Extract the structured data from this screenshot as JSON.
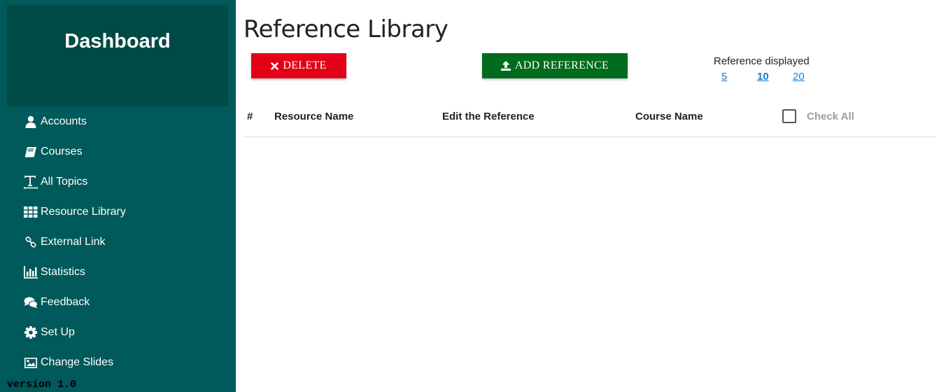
{
  "sidebar": {
    "brand": "Dashboard",
    "items": [
      {
        "label": "Accounts",
        "icon": "user-icon"
      },
      {
        "label": "Courses",
        "icon": "book-icon"
      },
      {
        "label": "All Topics",
        "icon": "text-icon"
      },
      {
        "label": "Resource Library",
        "icon": "grid-icon"
      },
      {
        "label": "External Link",
        "icon": "link-icon"
      },
      {
        "label": "Statistics",
        "icon": "bar-chart-icon"
      },
      {
        "label": "Feedback",
        "icon": "comments-icon"
      },
      {
        "label": "Set Up",
        "icon": "gear-icon"
      },
      {
        "label": "Change Slides",
        "icon": "image-icon"
      }
    ],
    "version": "version 1.0"
  },
  "main": {
    "title": "Reference Library",
    "delete_label": "DELETE",
    "add_label": "ADD REFERENCE",
    "per_page": {
      "label": "Reference displayed",
      "options": [
        "5",
        "10",
        "20"
      ],
      "selected": "10"
    },
    "table": {
      "headers": [
        "#",
        "Resource Name",
        "Edit the Reference",
        "Course Name"
      ],
      "check_all": "Check All",
      "rows": []
    }
  },
  "colors": {
    "sidebar": "#00595a",
    "brand": "#004a45",
    "delete": "#e30017",
    "add": "#006b1d",
    "link": "#1a7bd3"
  }
}
